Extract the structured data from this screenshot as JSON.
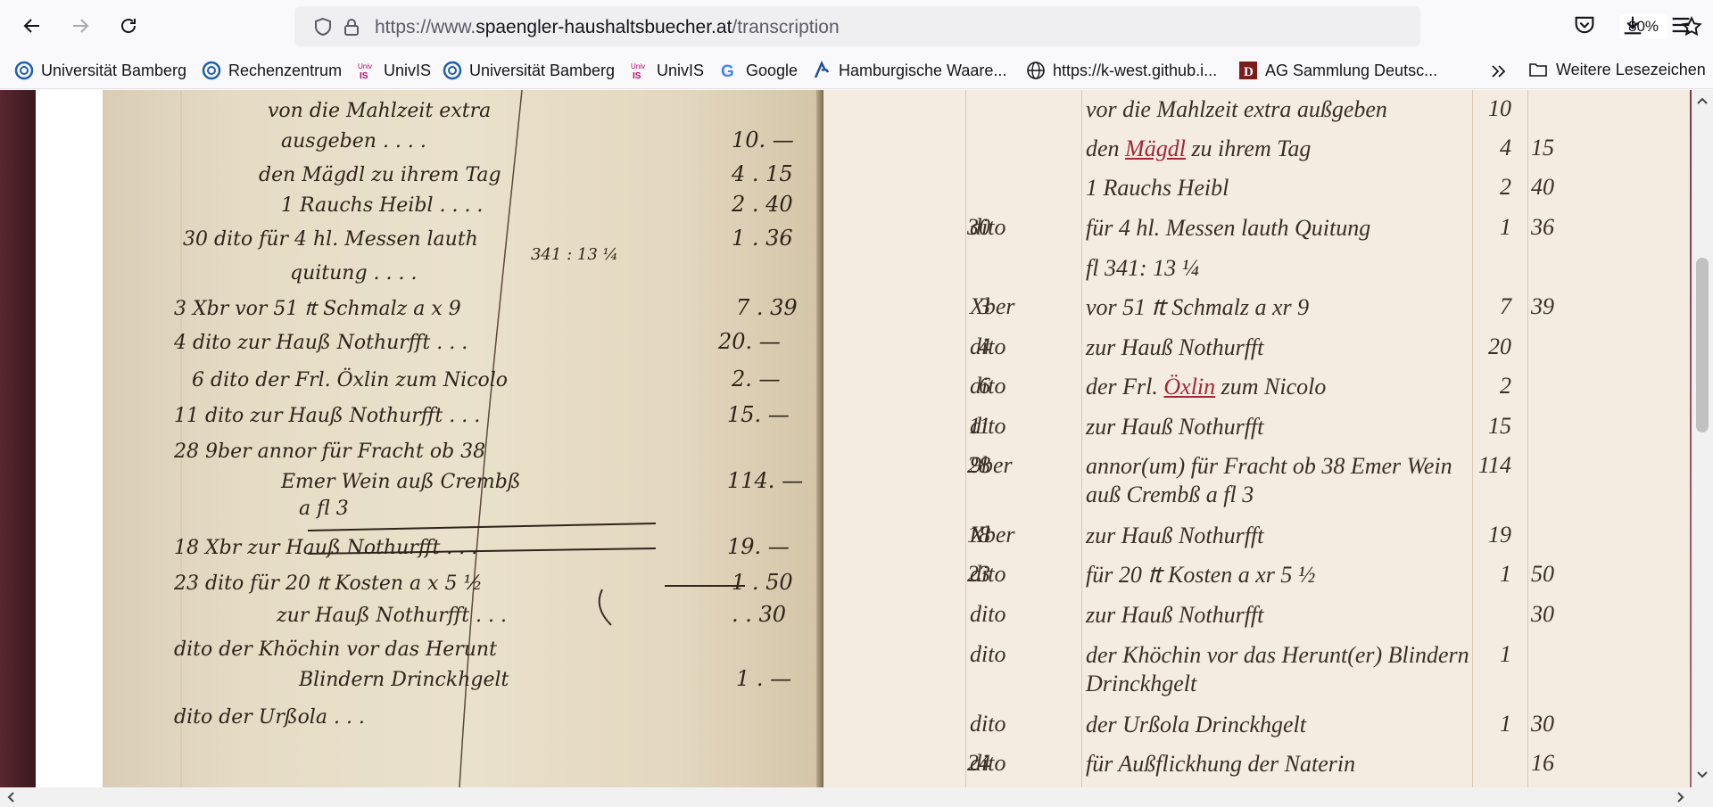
{
  "browser": {
    "url_prefix": "https://www.",
    "url_host": "spaengler-haushaltsbuecher.at",
    "url_path": "/transcription",
    "zoom": "80%"
  },
  "bookmarks": [
    {
      "label": "Universität Bamberg",
      "icon": "bamberg-logo-icon"
    },
    {
      "label": "Rechenzentrum",
      "icon": "bamberg-logo-icon"
    },
    {
      "label": "UnivIS",
      "icon": "univis-logo-icon"
    },
    {
      "label": "Universität Bamberg",
      "icon": "bamberg-logo-icon"
    },
    {
      "label": "UnivIS",
      "icon": "univis-logo-icon"
    },
    {
      "label": "Google",
      "icon": "google-logo-icon"
    },
    {
      "label": "Hamburgische Waare...",
      "icon": "hamburg-logo-icon"
    },
    {
      "label": "https://k-west.github.i...",
      "icon": "globe-icon"
    },
    {
      "label": "AG Sammlung Deutsc...",
      "icon": "ag-logo-icon"
    }
  ],
  "bookmarks_more_label": "Weitere Lesezeichen",
  "transcription": {
    "rows": [
      {
        "day": "",
        "month": "",
        "text": "vor die Mahlzeit extra außgeben",
        "fl": "10",
        "xr": ""
      },
      {
        "day": "",
        "month": "",
        "text_pre": "den ",
        "text_link": "Mägdl",
        "text_post": " zu ihrem Tag",
        "fl": "4",
        "xr": "15"
      },
      {
        "day": "",
        "month": "",
        "text": "1 Rauchs Heibl",
        "fl": "2",
        "xr": "40"
      },
      {
        "day": "30",
        "month": "dito",
        "text": "für 4 hl. Messen lauth Quitung",
        "fl": "1",
        "xr": "36"
      },
      {
        "day": "",
        "month": "",
        "text": "fl 341: 13 ¼",
        "fl": "",
        "xr": ""
      },
      {
        "day": "3",
        "month": "Xber",
        "text": "vor 51 ₶ Schmalz a xr 9",
        "fl": "7",
        "xr": "39"
      },
      {
        "day": "4",
        "month": "dito",
        "text": "zur Hauß Nothurfft",
        "fl": "20",
        "xr": ""
      },
      {
        "day": "6",
        "month": "dito",
        "text_pre": "der Frl. ",
        "text_link": "Öxlin",
        "text_post": " zum Nicolo",
        "fl": "2",
        "xr": ""
      },
      {
        "day": "11",
        "month": "dito",
        "text": "zur Hauß Nothurfft",
        "fl": "15",
        "xr": ""
      },
      {
        "day": "28",
        "month": "9ber",
        "text": "annor(um) für Fracht ob 38 Emer Wein auß Crembß a fl 3",
        "fl": "114",
        "xr": ""
      },
      {
        "day": "18",
        "month": "Xber",
        "text": "zur Hauß Nothurfft",
        "fl": "19",
        "xr": ""
      },
      {
        "day": "23",
        "month": "dito",
        "text": "für 20 ₶ Kosten a xr 5 ½",
        "fl": "1",
        "xr": "50"
      },
      {
        "day": "",
        "month": "dito",
        "text": "zur Hauß Nothurfft",
        "fl": "",
        "xr": "30"
      },
      {
        "day": "",
        "month": "dito",
        "text": "der Khöchin vor das Herunt(er) Blindern Drinckhgelt",
        "fl": "1",
        "xr": ""
      },
      {
        "day": "",
        "month": "dito",
        "text": "der Urßola Drinckhgelt",
        "fl": "1",
        "xr": "30"
      },
      {
        "day": "24",
        "month": "dito",
        "text": "für Außflickhung der Naterin",
        "fl": "",
        "xr": "16"
      }
    ]
  },
  "manuscript": {
    "lines": [
      "von die Mahlzeit extra",
      "ausgeben  . . . .",
      "den Mägdl zu ihrem Tag",
      "1 Rauchs Heibl . . . .",
      "30 dito für 4 hl. Messen lauth",
      "quitung . . . .",
      "3 Xbr vor 51 ₶ Schmalz a x 9",
      "4 dito zur Hauß Nothurfft . . .",
      "6 dito der Frl. Öxlin zum Nicolo",
      "11 dito zur Hauß Nothurfft . . .",
      "28 9ber annor für Fracht ob 38",
      "Emer Wein auß Crembß",
      "a fl 3",
      "18 Xbr zur Hauß Nothurfft . . .",
      "23 dito für 20 ₶ Kosten a x 5 ½",
      "zur Hauß Nothurfft . . .",
      "dito der Khöchin vor das Herunt",
      "Blindern Drinckhgelt",
      "dito der Urßola . . ."
    ],
    "amounts": [
      "10. —",
      "4 . 15",
      "2 . 40",
      "1 . 36",
      "341 : 13 ¼",
      "7 . 39",
      "20. —",
      "2. —",
      "15. —",
      "114. —",
      "19. —",
      "1 . 50",
      ". . 30",
      "1 . —"
    ]
  }
}
